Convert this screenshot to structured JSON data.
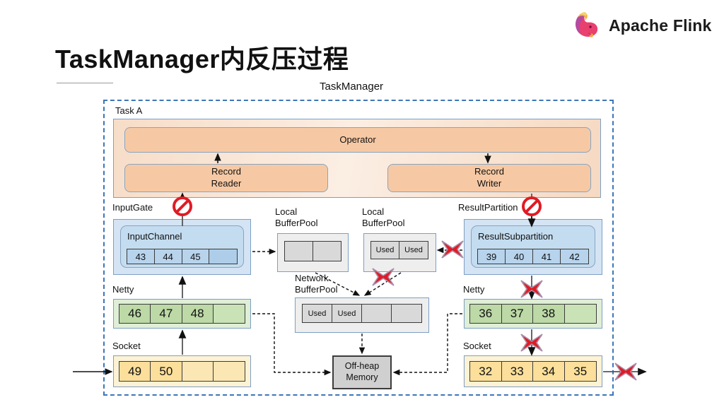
{
  "header": {
    "brand": "Apache Flink",
    "logo_icon": "flink-squirrel-logo"
  },
  "title": "TaskManager内反压过程",
  "diagram": {
    "taskmanager_label": "TaskManager",
    "task_label": "Task A",
    "operator_label": "Operator",
    "record_reader_label": "Record\nReader",
    "record_reader_line1": "Record",
    "record_reader_line2": "Reader",
    "record_writer_line1": "Record",
    "record_writer_line2": "Writer",
    "input_gate_label": "InputGate",
    "input_channel_label": "InputChannel",
    "input_channel_cells": [
      "43",
      "44",
      "45",
      ""
    ],
    "local_bufferpool_left_line1": "Local",
    "local_bufferpool_left_line2": "BufferPool",
    "local_bufferpool_left_cells": [
      "",
      ""
    ],
    "local_bufferpool_right_line1": "Local",
    "local_bufferpool_right_line2": "BufferPool",
    "local_bufferpool_right_cells": [
      "Used",
      "Used"
    ],
    "network_bufferpool_line1": "Network",
    "network_bufferpool_line2": "BufferPool",
    "network_bufferpool_cells": [
      "Used",
      "Used",
      "",
      ""
    ],
    "result_partition_label": "ResultPartition",
    "result_subpartition_label": "ResultSubpartition",
    "result_subpartition_cells": [
      "39",
      "40",
      "41",
      "42"
    ],
    "netty_left_label": "Netty",
    "netty_left_cells": [
      "46",
      "47",
      "48",
      ""
    ],
    "socket_left_label": "Socket",
    "socket_left_cells": [
      "49",
      "50",
      "",
      ""
    ],
    "netty_right_label": "Netty",
    "netty_right_cells": [
      "36",
      "37",
      "38",
      ""
    ],
    "socket_right_label": "Socket",
    "socket_right_cells": [
      "32",
      "33",
      "34",
      "35"
    ],
    "offheap_line1": "Off-heap",
    "offheap_line2": "Memory",
    "block_icon": "no-entry-icon",
    "cross_icon": "red-x-icon",
    "colors": {
      "taskmanager_border": "#3d76b8",
      "blue_fill": "#d4e4f4",
      "green_fill": "#dfeed6",
      "yellow_fill": "#fdf2d3",
      "gray_fill": "#eeeeee",
      "orange_fill": "#f6c9a4",
      "blocked_red": "#e01b24"
    }
  }
}
